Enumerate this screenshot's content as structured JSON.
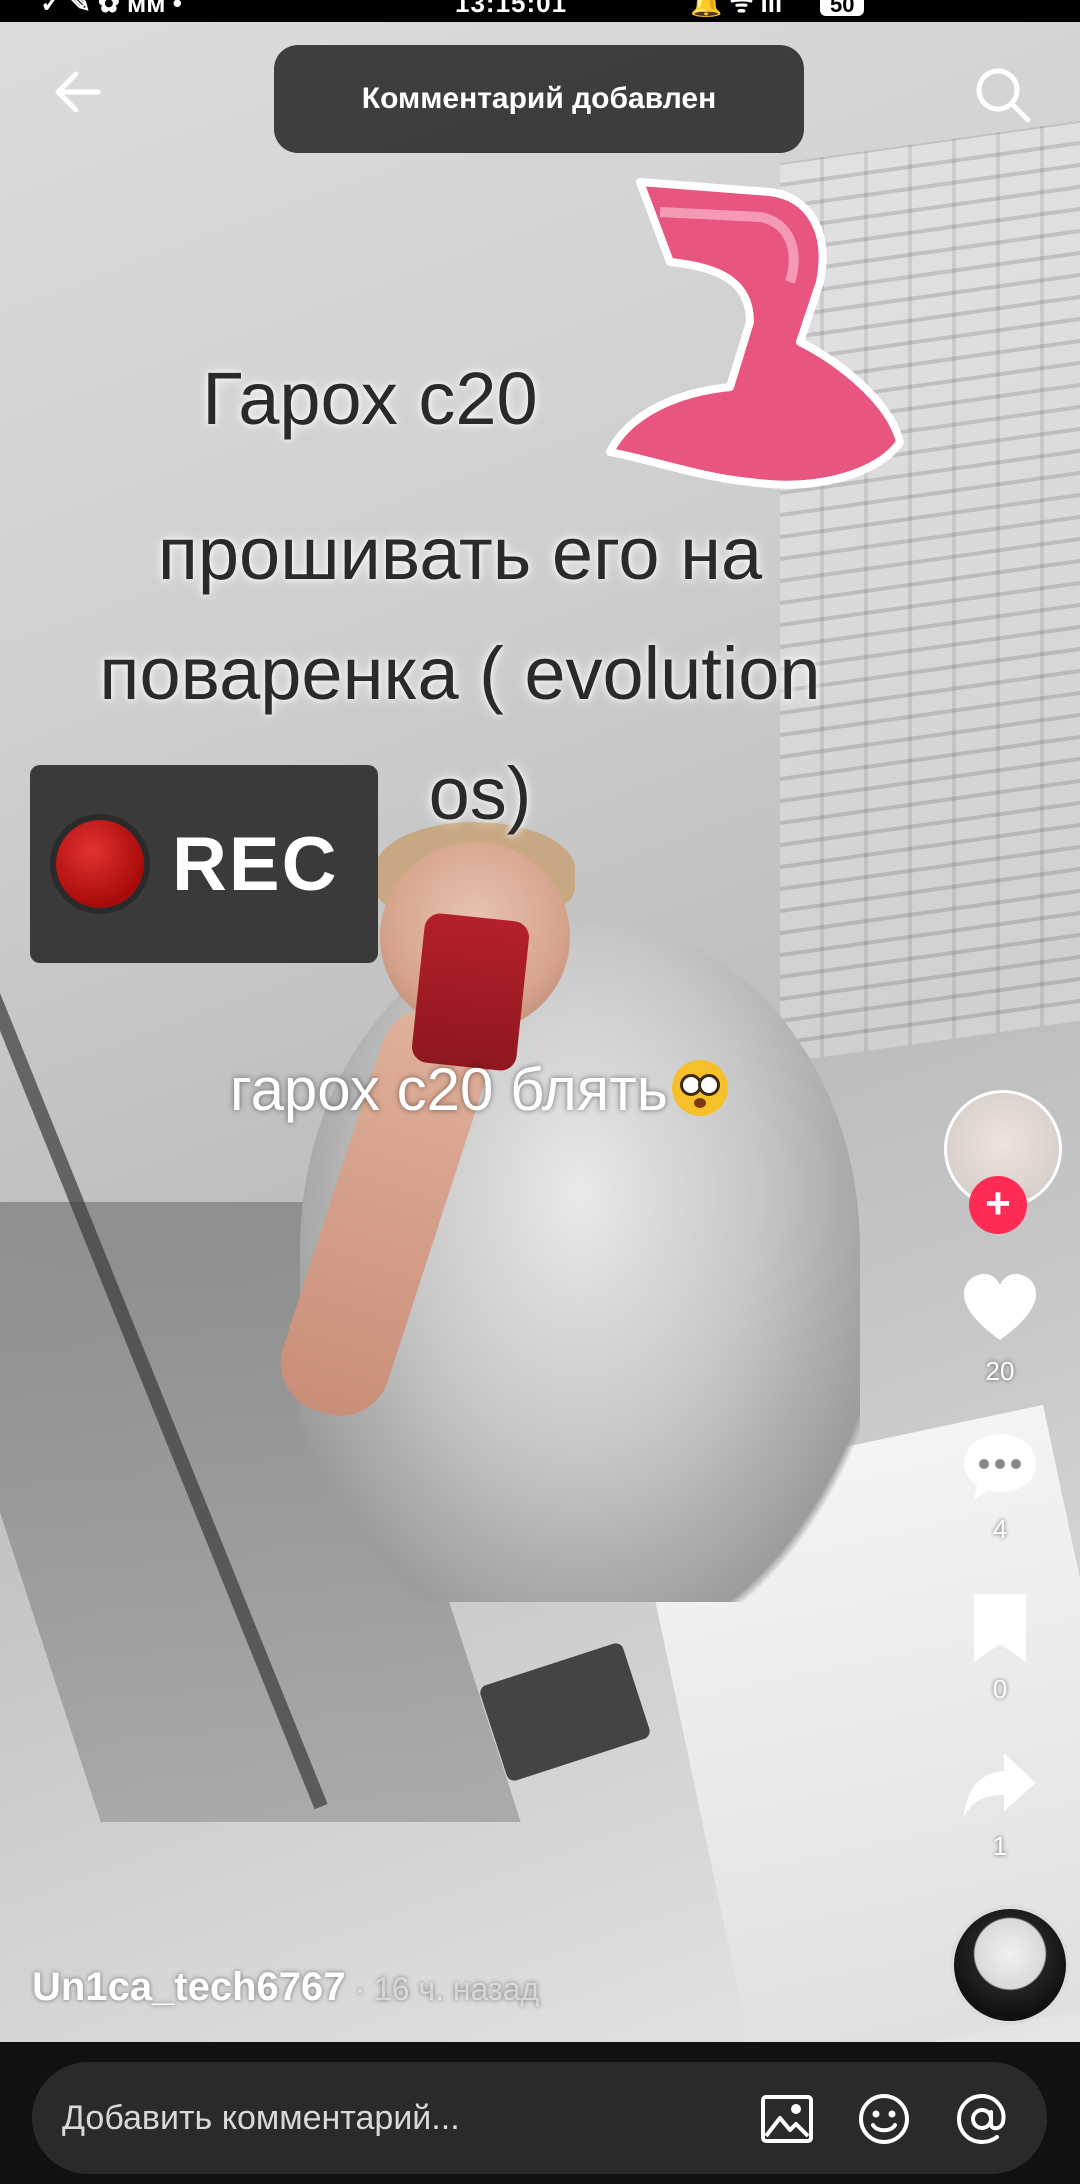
{
  "status_bar": {
    "time": "13:15:01",
    "left_indicators": "✓ ✎ ✿ мм •",
    "right_indicators": "🔔 ᯤ ıll",
    "battery": "50"
  },
  "toast": {
    "text": "Комментарий добавлен"
  },
  "overlay": {
    "caption_line1": "Гарох с20",
    "caption_line2": "прошивать его на",
    "caption_line3": "поваренка ( evolution",
    "caption_line4": "os)",
    "rec_label": "REC",
    "comment_text": "гарох с20 блять"
  },
  "actions": {
    "likes": "20",
    "comments": "4",
    "saves": "0",
    "shares": "1"
  },
  "author": {
    "username": "Un1ca_tech6767",
    "time_ago": " · 16 ч. назад"
  },
  "comment_bar": {
    "placeholder": "Добавить комментарий..."
  },
  "colors": {
    "accent": "#fe2c55",
    "bar_bg": "#111111",
    "input_bg": "#2a2a2a"
  },
  "icons": [
    "back-arrow-icon",
    "search-icon",
    "follow-plus-icon",
    "heart-icon",
    "comment-icon",
    "bookmark-icon",
    "share-icon",
    "image-icon",
    "emoji-icon",
    "mention-icon"
  ]
}
